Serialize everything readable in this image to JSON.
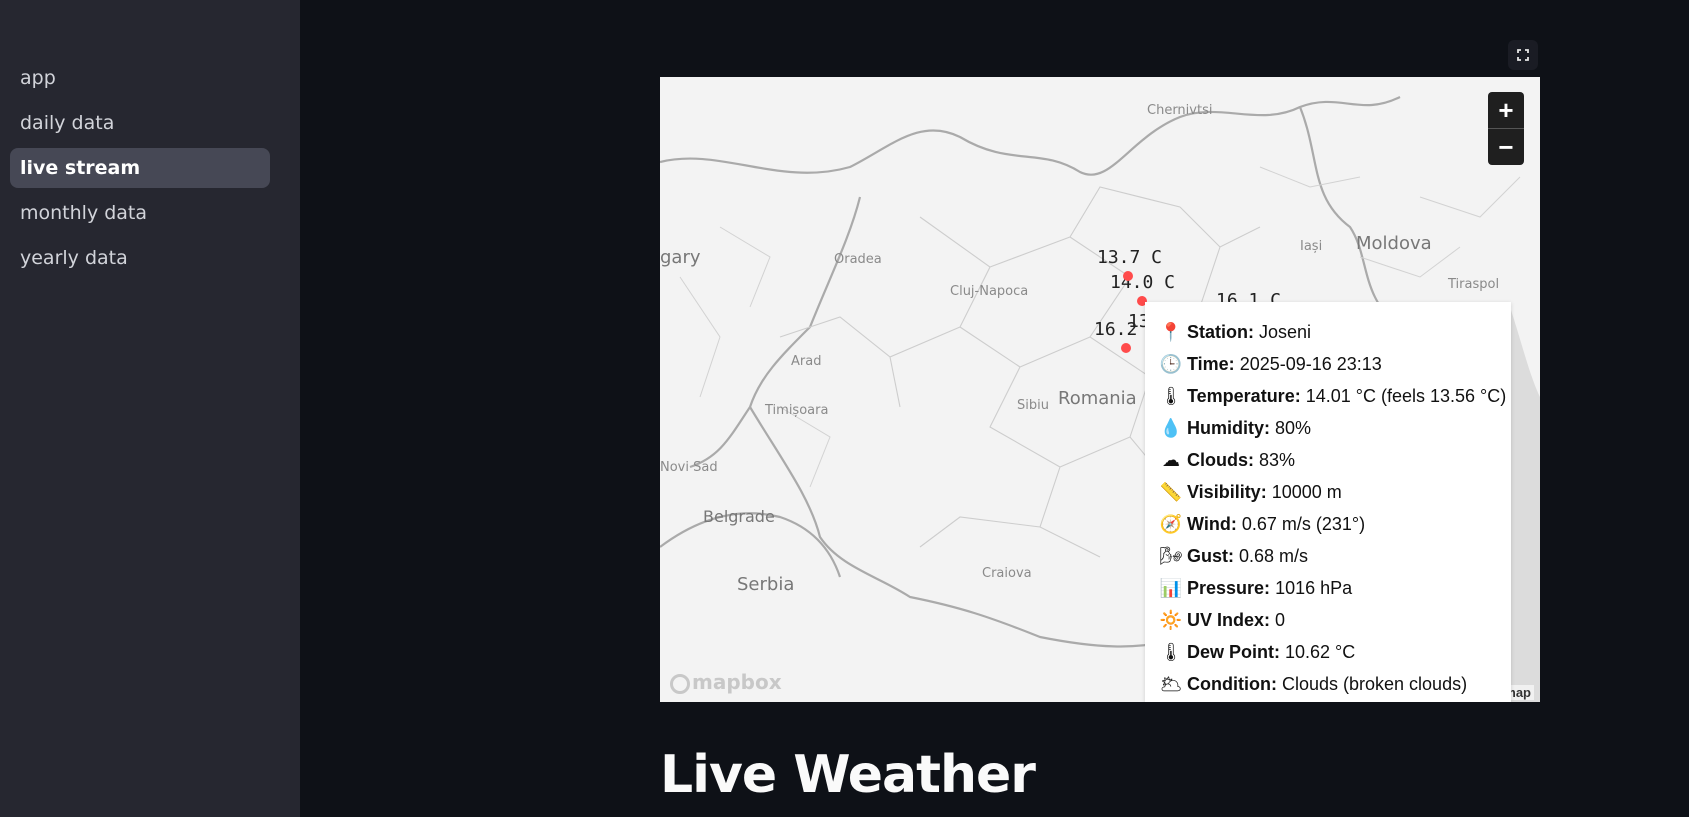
{
  "sidebar": {
    "items": [
      {
        "label": "app",
        "active": false
      },
      {
        "label": "daily data",
        "active": false
      },
      {
        "label": "live stream",
        "active": true
      },
      {
        "label": "monthly data",
        "active": false
      },
      {
        "label": "yearly data",
        "active": false
      }
    ]
  },
  "map": {
    "places": {
      "chernivtsi": "Chernivtsi",
      "moldova": "Moldova",
      "iasi": "Iași",
      "tiraspol": "Tiraspol",
      "hungary": "gary",
      "oradea": "Oradea",
      "cluj": "Cluj-Napoca",
      "arad": "Arad",
      "timisoara": "Timișoara",
      "sibiu": "Sibiu",
      "romania": "Romania",
      "novi_sad": "Novi Sad",
      "belgrade": "Belgrade",
      "serbia": "Serbia",
      "craiova": "Craiova"
    },
    "temperature_labels": [
      "13.7 C",
      "14.0 C",
      "16.2",
      "13",
      "16.1 C"
    ],
    "zoom_in": "+",
    "zoom_out": "−",
    "logo": "mapbox",
    "attribution": "map",
    "accent_color": "#ff4b4b"
  },
  "tooltip": {
    "rows": [
      {
        "icon": "📍",
        "icon_name": "pin-icon",
        "label": "Station:",
        "value": "Joseni"
      },
      {
        "icon": "🕒",
        "icon_name": "clock-icon",
        "label": "Time:",
        "value": "2025-09-16 23:13"
      },
      {
        "icon": "🌡",
        "icon_name": "thermometer-icon",
        "label": "Temperature:",
        "value": "14.01 °C (feels 13.56 °C)"
      },
      {
        "icon": "💧",
        "icon_name": "droplet-icon",
        "label": "Humidity:",
        "value": "80%"
      },
      {
        "icon": "☁",
        "icon_name": "cloud-icon",
        "label": "Clouds:",
        "value": "83%"
      },
      {
        "icon": "📏",
        "icon_name": "ruler-icon",
        "label": "Visibility:",
        "value": "10000 m"
      },
      {
        "icon": "🧭",
        "icon_name": "compass-icon",
        "label": "Wind:",
        "value": "0.67 m/s (231°)"
      },
      {
        "icon": "🌬",
        "icon_name": "gust-icon",
        "label": "Gust:",
        "value": "0.68 m/s"
      },
      {
        "icon": "📊",
        "icon_name": "chart-icon",
        "label": "Pressure:",
        "value": "1016 hPa"
      },
      {
        "icon": "🔆",
        "icon_name": "sun-icon",
        "label": "UV Index:",
        "value": "0"
      },
      {
        "icon": "🌡",
        "icon_name": "thermometer-icon",
        "label": "Dew Point:",
        "value": "10.62 °C"
      },
      {
        "icon": "🌥",
        "icon_name": "cloud-sun-icon",
        "label": "Condition:",
        "value": "Clouds (broken clouds)"
      }
    ]
  },
  "page_title": "Live Weather"
}
